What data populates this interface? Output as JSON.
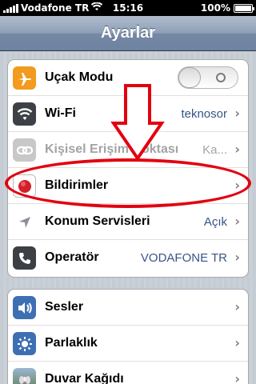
{
  "status_bar": {
    "carrier": "Vodafone TR",
    "time": "15:16",
    "battery": "100%",
    "battery_level": 1.0
  },
  "nav": {
    "title": "Ayarlar"
  },
  "groups": [
    {
      "rows": [
        {
          "label": "Uçak Modu",
          "icon": "airplane-icon",
          "icon_color": "#f29b1e",
          "control": "toggle",
          "toggle_on": false
        },
        {
          "label": "Wi-Fi",
          "icon": "wifi-icon",
          "icon_color": "#3d4147",
          "value": "teknosor"
        },
        {
          "label": "Kişisel Erişim Noktası",
          "icon": "personal-hotspot-icon",
          "icon_color": "#c8c8c8",
          "value": "Ka...",
          "disabled": true
        },
        {
          "label": "Bildirimler",
          "icon": "notifications-icon",
          "icon_color": "#d3202a"
        },
        {
          "label": "Konum Servisleri",
          "icon": "location-icon",
          "icon_color": "#8a8f96",
          "value": "Açık"
        },
        {
          "label": "Operatör",
          "icon": "phone-icon",
          "icon_color": "#3c3f44",
          "value": "VODAFONE TR"
        }
      ]
    },
    {
      "rows": [
        {
          "label": "Sesler",
          "icon": "speaker-icon",
          "icon_color": "#3f6fb3"
        },
        {
          "label": "Parlaklık",
          "icon": "brightness-icon",
          "icon_color": "#3f6fb3"
        },
        {
          "label": "Duvar Kağıdı",
          "icon": "wallpaper-icon",
          "icon_color": "#5d7f4a"
        }
      ]
    }
  ],
  "annotation": {
    "color": "#e3000f"
  }
}
